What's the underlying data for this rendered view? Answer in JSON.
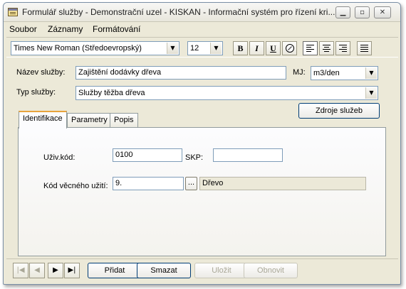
{
  "window": {
    "title": "Formulář služby - Demonstrační uzel - KISKAN - Informační systém pro řízení kri...",
    "minimize_glyph": "▁",
    "maximize_glyph": "▫",
    "close_glyph": "✕"
  },
  "menu": [
    "Soubor",
    "Záznamy",
    "Formátování"
  ],
  "toolbar": {
    "font_name": "Times New Roman (Středoevropský)",
    "font_size": "12",
    "bold": "B",
    "italic": "I",
    "underline": "U",
    "color_icon": "color-picker-icon"
  },
  "form": {
    "nazev_label": "Název služby:",
    "nazev_value": "Zajištění dodávky dřeva",
    "mj_label": "MJ:",
    "mj_value": "m3/den",
    "typ_label": "Typ služby:",
    "typ_value": "Služby těžba dřeva",
    "zdroje_button": "Zdroje služeb"
  },
  "tabs": [
    "Identifikace",
    "Parametry",
    "Popis"
  ],
  "identifikace": {
    "uziv_kod_label": "Uživ.kód:",
    "uziv_kod_value": "0100",
    "skp_label": "SKP:",
    "skp_value": "",
    "kod_label": "Kód věcného užití:",
    "kod_value": "9.",
    "browse_label": "...",
    "kod_description": "Dřevo"
  },
  "navigation": {
    "first": "|◀",
    "prev": "◀",
    "next": "▶",
    "last": "▶|"
  },
  "actions": {
    "pridat": "Přidat",
    "smazat": "Smazat",
    "ulozit": "Uložit",
    "obnovit": "Obnovit"
  },
  "colors": {
    "window_bg": "#ece9d8",
    "tab_accent": "#e8a33c",
    "field_border": "#7f9db9"
  }
}
